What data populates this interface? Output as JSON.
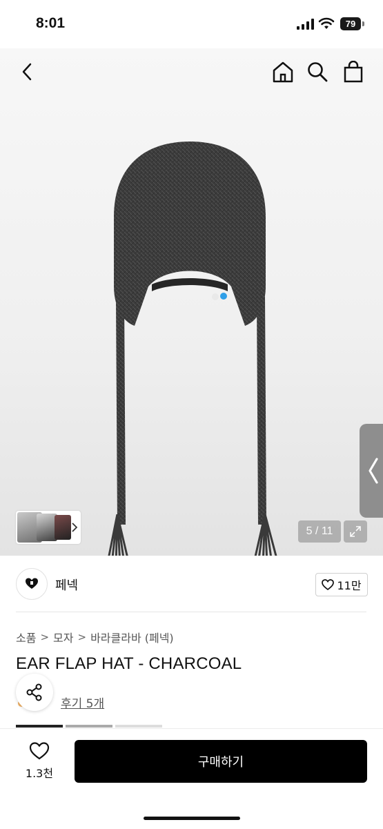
{
  "status_bar": {
    "time": "8:01",
    "battery": "79"
  },
  "gallery": {
    "counter": "5 / 11"
  },
  "brand": {
    "name": "페넥",
    "likes": "11만"
  },
  "breadcrumb": [
    "소품",
    "모자",
    "바라클라바 (페넥)"
  ],
  "product": {
    "title": "EAR FLAP HAT - CHARCOAL",
    "reviews": "후기 5개"
  },
  "bottom": {
    "wish_count": "1.3천",
    "buy_label": "구매하기"
  },
  "colors": {
    "accent": "#000000",
    "hat": "#3a3a3a",
    "tag_blue": "#2f9fe8"
  },
  "icons": [
    "back-icon",
    "home-icon",
    "search-icon",
    "bag-icon",
    "expand-icon",
    "heart-icon",
    "share-icon",
    "chevron-right-icon"
  ]
}
